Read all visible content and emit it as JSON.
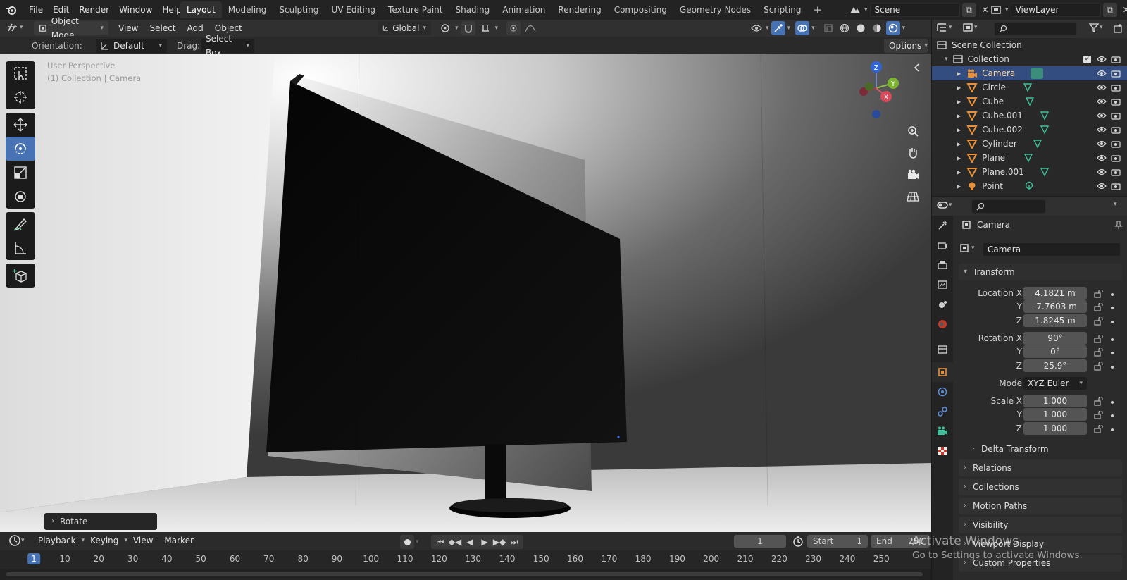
{
  "app": {
    "menu": [
      "File",
      "Edit",
      "Render",
      "Window",
      "Help"
    ],
    "workspaces": [
      "Layout",
      "Modeling",
      "Sculpting",
      "UV Editing",
      "Texture Paint",
      "Shading",
      "Animation",
      "Rendering",
      "Compositing",
      "Geometry Nodes",
      "Scripting"
    ],
    "active_workspace": "Layout",
    "scene_name": "Scene",
    "view_layer": "ViewLayer"
  },
  "viewport_header": {
    "mode": "Object Mode",
    "menus": [
      "View",
      "Select",
      "Add",
      "Object"
    ],
    "transform_orientation": "Global"
  },
  "tool_settings": {
    "orientation_label": "Orientation:",
    "orientation_value": "Default",
    "drag_label": "Drag:",
    "drag_value": "Select Box",
    "options_label": "Options"
  },
  "viewport": {
    "perspective_label": "User Perspective",
    "collection_label": "(1) Collection | Camera",
    "gizmo_axes": [
      "Z",
      "Y",
      "X"
    ],
    "last_operator": "Rotate"
  },
  "timeline": {
    "menus": [
      "Playback",
      "Keying",
      "View",
      "Marker"
    ],
    "current_frame": "1",
    "start_label": "Start",
    "start_value": "1",
    "end_label": "End",
    "end_value": "250",
    "ticks": [
      "1",
      "10",
      "20",
      "30",
      "40",
      "50",
      "60",
      "70",
      "80",
      "90",
      "100",
      "110",
      "120",
      "130",
      "140",
      "150",
      "160",
      "170",
      "180",
      "190",
      "200",
      "210",
      "220",
      "230",
      "240",
      "250"
    ]
  },
  "outliner": {
    "scene_collection": "Scene Collection",
    "collection": "Collection",
    "items": [
      {
        "name": "Camera",
        "type": "camera",
        "selected": true
      },
      {
        "name": "Circle",
        "type": "mesh"
      },
      {
        "name": "Cube",
        "type": "mesh"
      },
      {
        "name": "Cube.001",
        "type": "mesh"
      },
      {
        "name": "Cube.002",
        "type": "mesh"
      },
      {
        "name": "Cylinder",
        "type": "mesh"
      },
      {
        "name": "Plane",
        "type": "mesh"
      },
      {
        "name": "Plane.001",
        "type": "mesh"
      },
      {
        "name": "Point",
        "type": "light"
      }
    ]
  },
  "properties": {
    "object_name": "Camera",
    "data_name": "Camera",
    "transform_label": "Transform",
    "location_label": "Location X",
    "rotation_label": "Rotation X",
    "scale_label": "Scale X",
    "y_label": "Y",
    "z_label": "Z",
    "location": [
      "4.1821 m",
      "-7.7603 m",
      "1.8245 m"
    ],
    "rotation": [
      "90°",
      "0°",
      "25.9°"
    ],
    "mode_label": "Mode",
    "mode_value": "XYZ Euler",
    "scale": [
      "1.000",
      "1.000",
      "1.000"
    ],
    "delta_transform": "Delta Transform",
    "panels": [
      "Relations",
      "Collections",
      "Motion Paths",
      "Visibility",
      "Viewport Display",
      "Custom Properties"
    ]
  },
  "watermark": {
    "line1": "Activate Windows",
    "line2": "Go to Settings to activate Windows."
  },
  "colors": {
    "accent": "#4772b3",
    "selection": "#334d80",
    "mesh_icon": "#e8913c",
    "data_icon": "#3fbf9a"
  }
}
